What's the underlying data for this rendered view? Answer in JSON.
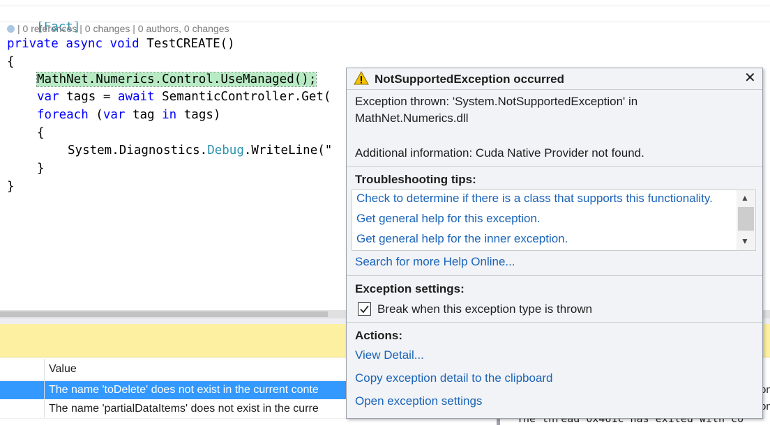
{
  "code": {
    "attribute": "[Fact]",
    "lens": "| 0 references | 0 changes | 0 authors, 0 changes",
    "line_signature": [
      "private",
      "async",
      "void",
      "TestCREATE()"
    ],
    "open_brace": "{",
    "line_usemanaged": "MathNet.Numerics.Control.UseManaged();",
    "line_tags": {
      "kw": "var",
      "a": " tags = ",
      "kw2": "await",
      "b": " SemanticController.Get("
    },
    "line_foreach": {
      "kw": "foreach",
      "a": " (",
      "kw2": "var",
      "b": " tag ",
      "kw3": "in",
      "c": " tags)"
    },
    "inner_open": "{",
    "line_debug": {
      "a": "System.Diagnostics.",
      "type": "Debug",
      "b": ".WriteLine(\""
    },
    "inner_close": "}",
    "close_brace": "}"
  },
  "locals": {
    "column_value": "Value",
    "rows": [
      "The name 'toDelete' does not exist in the current conte",
      "The name 'partialDataItems' does not exist in the curre"
    ],
    "right_bits": [
      "on",
      "on"
    ]
  },
  "output": {
    "text": "The thread 0x461c has exited with co"
  },
  "exception": {
    "title": "NotSupportedException occurred",
    "close_glyph": "✕",
    "thrown_line1": "Exception thrown: 'System.NotSupportedException' in",
    "thrown_line2": "MathNet.Numerics.dll",
    "additional": "Additional information: Cuda Native Provider not found.",
    "tips_heading": "Troubleshooting tips:",
    "tips": [
      "Check to determine if there is a class that supports this functionality.",
      "Get general help for this exception.",
      "Get general help for the inner exception."
    ],
    "search_link": "Search for more Help Online...",
    "settings_heading": "Exception settings:",
    "break_label": "Break when this exception type is thrown",
    "break_checked": true,
    "actions_heading": "Actions:",
    "actions": [
      "View Detail...",
      "Copy exception detail to the clipboard",
      "Open exception settings"
    ]
  },
  "colors": {
    "warning": "#f5c400",
    "link": "#1a63b8",
    "selection": "#3399ff",
    "keyword": "#0000ff",
    "type": "#2b91af"
  }
}
